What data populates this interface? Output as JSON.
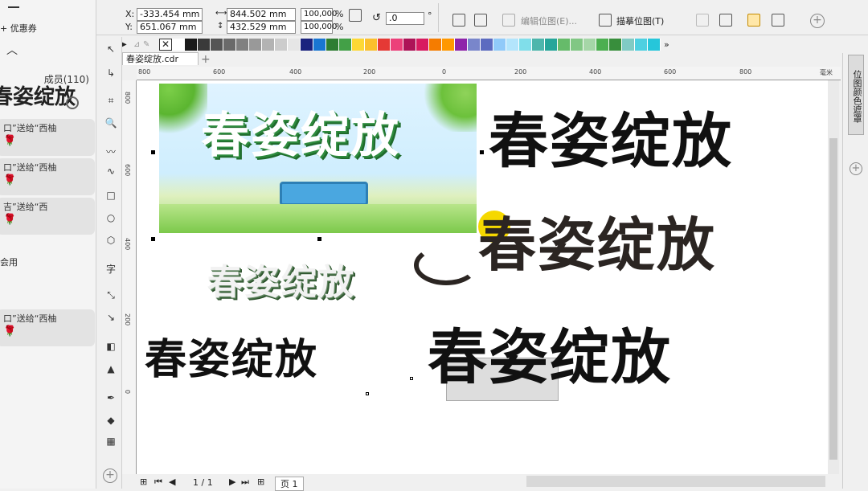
{
  "chat": {
    "coupon": "+ 优惠券",
    "members": "成员(110)",
    "big_text": "春姿绽放",
    "messages": [
      "口”送给“西柚",
      "口”送给“西柚",
      "吉”送给“西",
      "口”送给“西柚"
    ],
    "use_text": "会用"
  },
  "toolbar": {
    "x_label": "X:",
    "x_value": "-333.454 mm",
    "y_label": "Y:",
    "y_value": "651.067 mm",
    "w_value": "844.502 mm",
    "h_value": "432.529 mm",
    "scale_x": "100,000",
    "scale_y": "100,000",
    "pct": "%",
    "angle": ".0",
    "degree": "°",
    "edit_bitmap": "编辑位图(E)...",
    "trace_bitmap": "描摹位图(T)"
  },
  "palette": [
    "#ffffff",
    "#1a1a1a",
    "#3a3a3a",
    "#555555",
    "#6a6a6a",
    "#808080",
    "#999999",
    "#b3b3b3",
    "#cccccc",
    "#e6e6e6",
    "#1a237e",
    "#1976d2",
    "#2e7d32",
    "#43a047",
    "#fdd835",
    "#fbc02d",
    "#e53935",
    "#ec407a",
    "#ad1457",
    "#d81b60",
    "#f57c00",
    "#ff9800",
    "#8e24aa",
    "#7986cb",
    "#5c6bc0",
    "#90caf9",
    "#b3e5fc",
    "#80deea",
    "#4db6ac",
    "#26a69a",
    "#66bb6a",
    "#81c784",
    "#a5d6a7",
    "#4caf50",
    "#388e3c",
    "#80cbc4",
    "#4dd0e1",
    "#26c6da"
  ],
  "doc_tab": "春姿绽放.cdr",
  "ruler": {
    "h_ticks": [
      "800",
      "600",
      "400",
      "200",
      "0",
      "200",
      "400",
      "600",
      "800"
    ],
    "unit": "毫米",
    "v_ticks": [
      "800",
      "600",
      "400",
      "200",
      "0"
    ]
  },
  "canvas": {
    "text1": "春姿绽放",
    "text2": "春姿绽放",
    "text3": "春姿绽放",
    "text4": "春姿绽放",
    "text5": "春姿绽放",
    "text6": "春姿绽放"
  },
  "bottom": {
    "page_count": "1 / 1",
    "page_tab": "页 1"
  },
  "right_panel": {
    "tab_label": "位图颜色遮罩"
  }
}
